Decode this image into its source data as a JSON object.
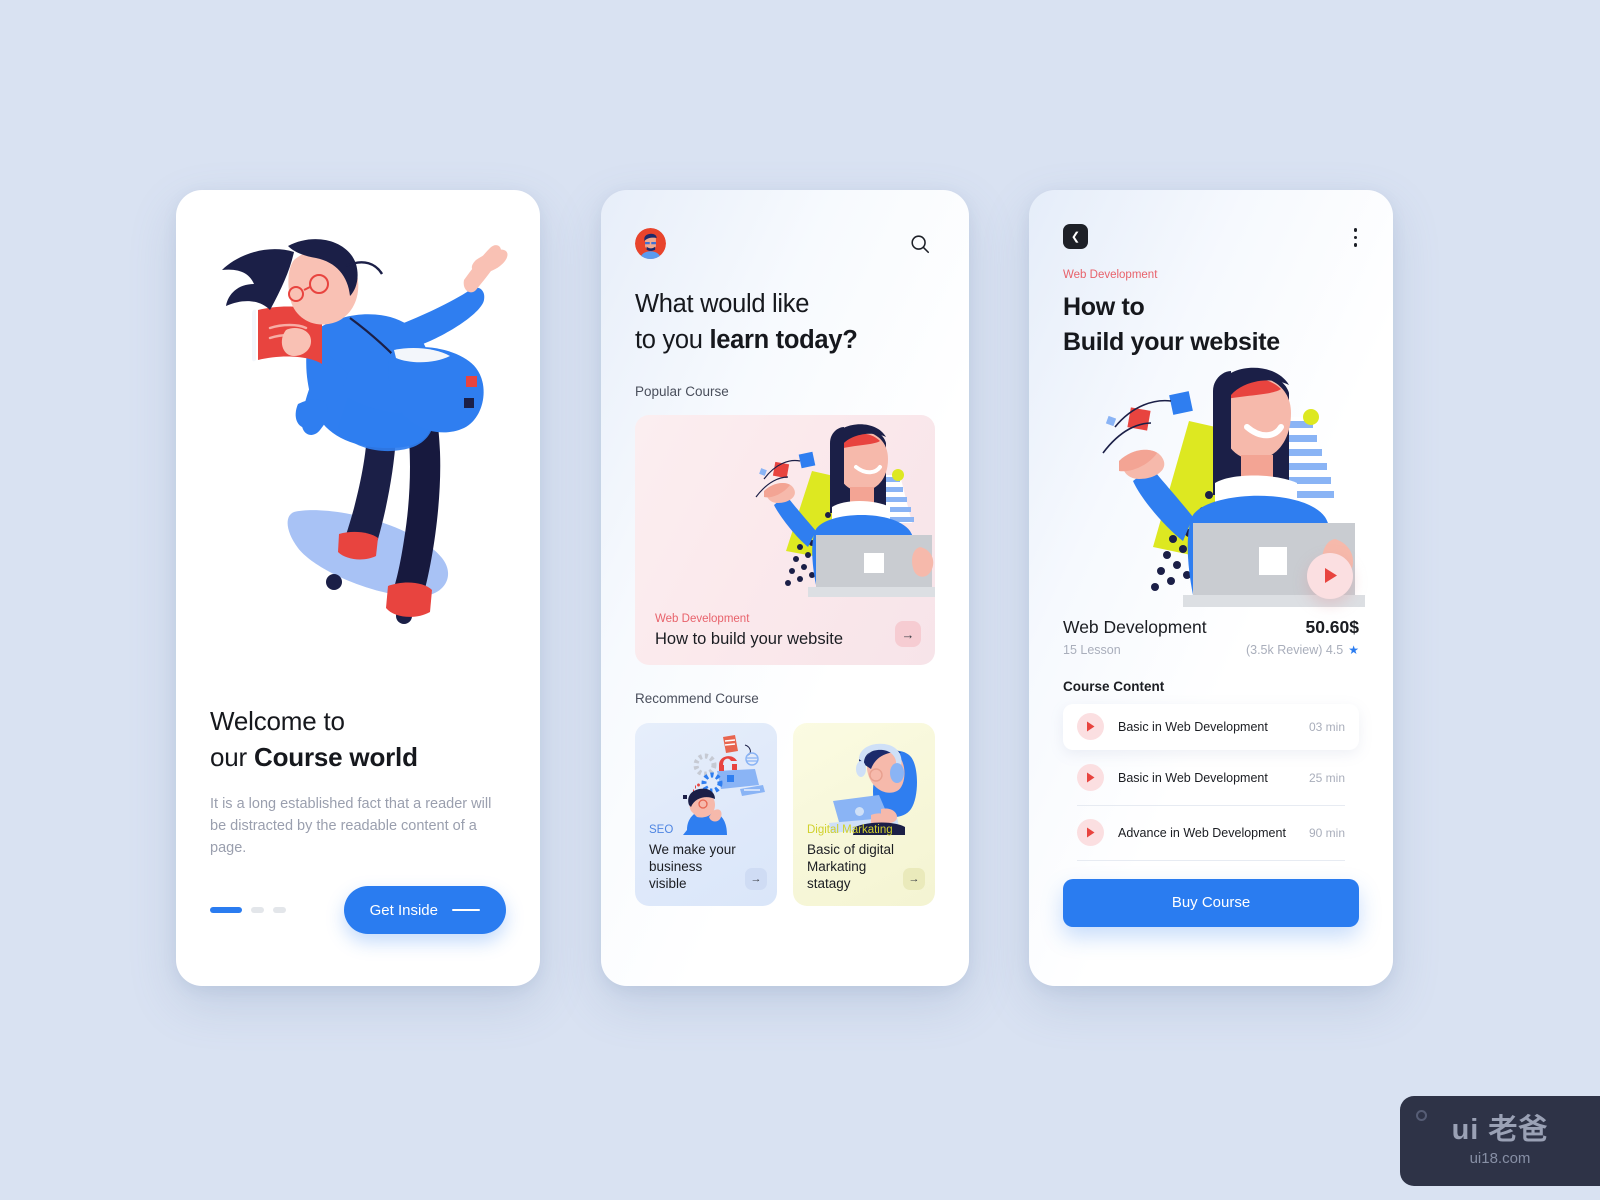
{
  "theme": {
    "page_background": "#d9e2f2",
    "accent_blue": "#2a7cf0",
    "accent_red": "#e8626b",
    "accent_olive": "#d0d12c",
    "text_dark": "#16181d",
    "text_muted": "#9a9fae"
  },
  "screen1": {
    "name": "onboarding",
    "illustration": "skateboarder-reading-book-illustration",
    "heading_line1": "Welcome to",
    "heading_line2_normal": "our ",
    "heading_line2_bold": "Course world",
    "body": "It is a long established fact that a reader will be distracted by the readable content of a page.",
    "pager": {
      "total": 3,
      "active_index": 0
    },
    "cta": {
      "label": "Get Inside",
      "icon": "dash-icon"
    }
  },
  "screen2": {
    "name": "course-discovery",
    "avatar": "user-avatar",
    "search_icon": "search-icon",
    "heading_line1": "What would like",
    "heading_line2_normal": "to you ",
    "heading_line2_bold": "learn today?",
    "popular_label": "Popular Course",
    "popular_card": {
      "kicker": "Web Development",
      "title": "How to build your website",
      "illustration": "woman-with-laptop-illustration",
      "arrow_icon": "arrow-right-icon"
    },
    "recommend_label": "Recommend Course",
    "recommend_cards": [
      {
        "kicker": "SEO",
        "title": "We make your business visible",
        "illustration": "person-with-floating-seo-icons-illustration",
        "arrow_icon": "arrow-right-icon"
      },
      {
        "kicker": "Digital Markating",
        "title": "Basic of digital Markating statagy",
        "illustration": "person-with-headphones-laptop-illustration",
        "arrow_icon": "arrow-right-icon"
      }
    ]
  },
  "screen3": {
    "name": "course-detail",
    "back_icon": "chevron-left-icon",
    "menu_icon": "kebab-menu-icon",
    "kicker": "Web Development",
    "title_line1": "How to",
    "title_line2": "Build your website",
    "illustration": "woman-with-laptop-illustration",
    "play_icon": "play-icon",
    "course_name": "Web Development",
    "price": "50.60$",
    "lessons": "15 Lesson",
    "reviews": "(3.5k Review) 4.5",
    "star_icon": "star-icon",
    "content_label": "Course Content",
    "content_items": [
      {
        "title": "Basic in Web Development",
        "duration": "03 min",
        "icon": "play-icon",
        "active": true
      },
      {
        "title": "Basic in Web Development",
        "duration": "25 min",
        "icon": "play-icon",
        "active": false
      },
      {
        "title": "Advance in Web Development",
        "duration": "90 min",
        "icon": "play-icon",
        "active": false
      }
    ],
    "buy_label": "Buy Course"
  },
  "watermark": {
    "main": "ui 老爸",
    "sub": "ui18.com",
    "dot_icon": "circle-icon"
  }
}
